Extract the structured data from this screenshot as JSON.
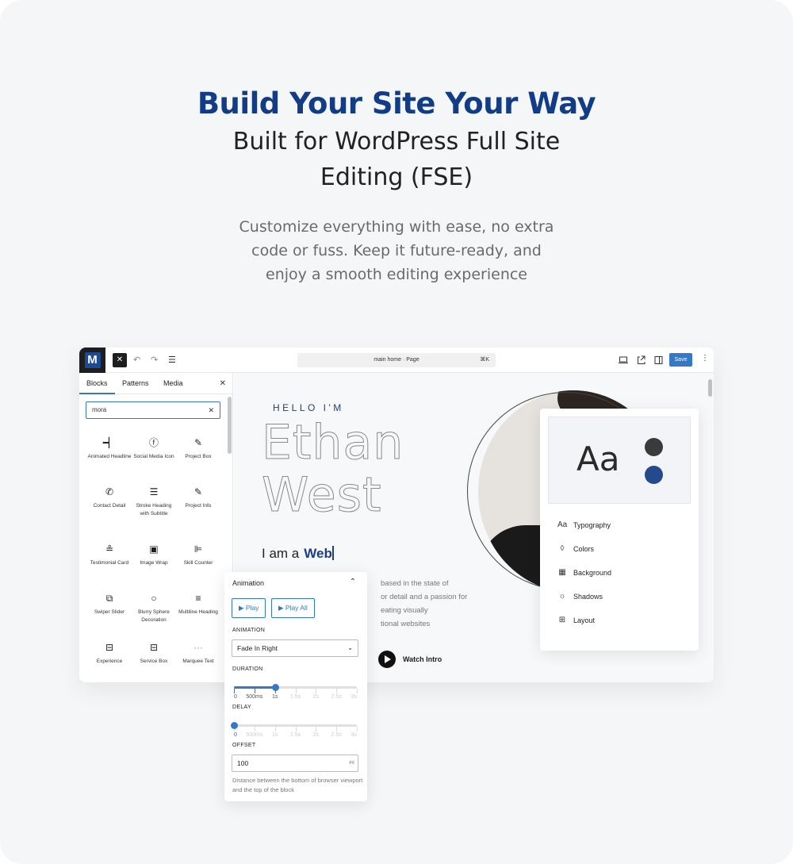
{
  "hero": {
    "title": "Build Your Site Your Way",
    "subtitle": "Built for WordPress Full Site Editing (FSE)",
    "description": "Customize everything with ease, no extra code or fuss. Keep it future-ready, and enjoy a smooth editing experience"
  },
  "colors": {
    "brand_blue": "#123d86",
    "accent_blue": "#3478c6",
    "swatch_dark": "#3a3a3a",
    "swatch_blue": "#234a8c"
  },
  "editor": {
    "logo_letter": "M",
    "close_label": "✕",
    "command_bar": {
      "label": "main home · Page",
      "shortcut": "⌘K"
    },
    "save_label": "Save",
    "more_label": "⋮",
    "icons": [
      "close-icon",
      "undo-icon",
      "redo-icon",
      "list-view-icon",
      "desktop-preview-icon",
      "external-link-icon",
      "sidebar-toggle-icon",
      "more-options-icon"
    ]
  },
  "inserter": {
    "tabs": [
      {
        "label": "Blocks",
        "active": true
      },
      {
        "label": "Patterns",
        "active": false
      },
      {
        "label": "Media",
        "active": false
      }
    ],
    "close_label": "✕",
    "search": {
      "value": "mora",
      "clear_label": "✕"
    },
    "blocks": [
      {
        "label": "Animated Headline",
        "icon": "━▏"
      },
      {
        "label": "Social Media Icon",
        "icon": "ⓕ"
      },
      {
        "label": "Project Box",
        "icon": "✎"
      },
      {
        "label": "Contact Detail",
        "icon": "✆"
      },
      {
        "label": "Stroke Heading with Subtitle",
        "icon": "☰"
      },
      {
        "label": "Project Info",
        "icon": "✎"
      },
      {
        "label": "Testimonial Card",
        "icon": "≗"
      },
      {
        "label": "Image Wrap",
        "icon": "▣"
      },
      {
        "label": "Skill Counter",
        "icon": "⊫"
      },
      {
        "label": "Swiper Slider",
        "icon": "⧉"
      },
      {
        "label": "Blurry Sphere Decoration",
        "icon": "○"
      },
      {
        "label": "Multiline Heading",
        "icon": "≡"
      },
      {
        "label": "Experience",
        "icon": "⊟"
      },
      {
        "label": "Service Box",
        "icon": "⊟"
      },
      {
        "label": "Marquee Text",
        "icon": "···"
      }
    ]
  },
  "canvas": {
    "greeting": "HELLO I'M",
    "first_name": "Ethan",
    "last_name": "West",
    "role_prefix": "I am a",
    "role_typed": "Web",
    "bio_lines": [
      "based in the state of",
      "or detail and a passion for",
      "eating visually",
      "tional websites"
    ],
    "watch_label": "Watch Intro"
  },
  "styles_panel": {
    "preview_text": "Aa",
    "items": [
      {
        "label": "Typography",
        "icon": "Aa"
      },
      {
        "label": "Colors",
        "icon": "◊"
      },
      {
        "label": "Background",
        "icon": "▦"
      },
      {
        "label": "Shadows",
        "icon": "☼"
      },
      {
        "label": "Layout",
        "icon": "⊞"
      }
    ]
  },
  "animation_panel": {
    "title": "Animation",
    "collapse_icon": "⌃",
    "play_label": "▶  Play",
    "play_all_label": "▶  Play All",
    "animation_label": "ANIMATION",
    "animation_value": "Fade In Right",
    "duration_label": "DURATION",
    "duration_value_s": 1,
    "delay_label": "DELAY",
    "delay_value_s": 0,
    "slider_ticks": [
      "0",
      "500ms",
      "1s",
      "1.5s",
      "2s",
      "2.5s",
      "3s"
    ],
    "slider_max_s": 3,
    "offset_label": "OFFSET",
    "offset_value": "100",
    "offset_unit": "PX",
    "help_text": "Distance between the bottom of browser viewport and the top of the block"
  }
}
